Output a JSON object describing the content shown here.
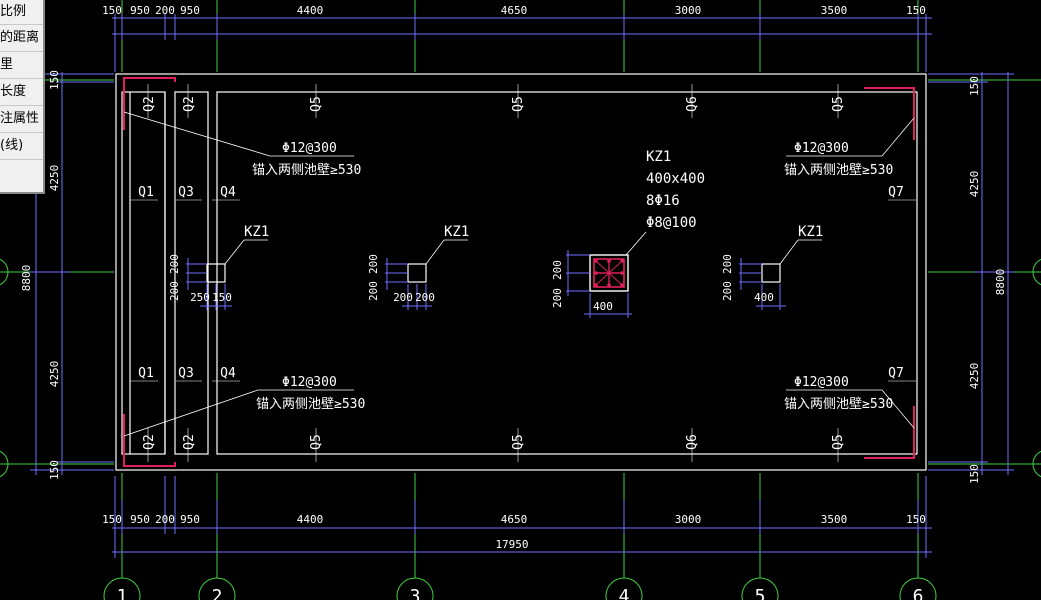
{
  "context_menu": {
    "items": [
      "比例",
      "的距离",
      "里",
      "长度",
      "注属性",
      "(线)"
    ]
  },
  "drawing": {
    "colors": {
      "background": "#000000",
      "axis_line": "#3ecf3e",
      "dimension": "#7070ff",
      "wall_line": "#ffffff",
      "text": "#ffffff",
      "rebar": "#e0205a"
    },
    "top_dims": [
      "150",
      "950",
      "200",
      "950",
      "4400",
      "4650",
      "3000",
      "3500",
      "150"
    ],
    "bottom_dims": [
      "150",
      "950",
      "200",
      "950",
      "4400",
      "4650",
      "3000",
      "3500",
      "150"
    ],
    "bottom_total": "17950",
    "left_dims": [
      "150",
      "4250",
      "4250",
      "150"
    ],
    "left_total": "8800",
    "right_dims": [
      "150",
      "4250",
      "4250",
      "150"
    ],
    "right_total": "8800",
    "axis_labels": [
      "1",
      "2",
      "3",
      "4",
      "5",
      "6"
    ],
    "wall_tags": {
      "q1": "Q1",
      "q2": "Q2",
      "q3": "Q3",
      "q4": "Q4",
      "q5": "Q5",
      "q6": "Q6",
      "q7": "Q7"
    },
    "rebar_note": "Φ12@300",
    "anchor_note": "锚入两侧池壁≥530",
    "column_tag": "KZ1",
    "column_detail": [
      "KZ1",
      "400x400",
      "8Φ16",
      "Φ8@100"
    ],
    "column_dims": {
      "c1_v": [
        "200",
        "200"
      ],
      "c1_h": [
        "250",
        "150"
      ],
      "c2_v": [
        "200",
        "200"
      ],
      "c2_h": [
        "200",
        "200"
      ],
      "c3_v": [
        "200",
        "200"
      ],
      "c3_h": [
        "400"
      ],
      "c4_v": [
        "200",
        "200"
      ],
      "c4_h": [
        "400"
      ]
    }
  }
}
